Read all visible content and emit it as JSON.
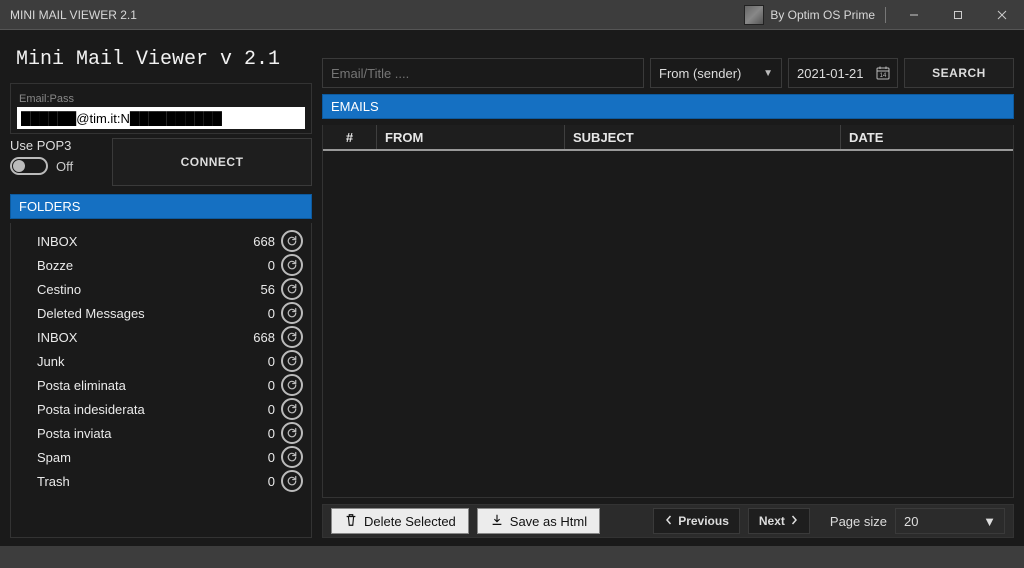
{
  "window": {
    "title": "MINI MAIL VIEWER 2.1",
    "author": "By Optim OS Prime"
  },
  "app": {
    "heading": "Mini Mail Viewer v 2.1"
  },
  "login": {
    "legend": "Email:Pass",
    "credential_value": "██████@tim.it:N██████████"
  },
  "pop3": {
    "label": "Use POP3",
    "state": "Off"
  },
  "connect": {
    "label": "CONNECT"
  },
  "folders_header": "FOLDERS",
  "folders": [
    {
      "name": "INBOX",
      "count": 668
    },
    {
      "name": "Bozze",
      "count": 0
    },
    {
      "name": "Cestino",
      "count": 56
    },
    {
      "name": "Deleted Messages",
      "count": 0
    },
    {
      "name": "INBOX",
      "count": 668
    },
    {
      "name": "Junk",
      "count": 0
    },
    {
      "name": "Posta eliminata",
      "count": 0
    },
    {
      "name": "Posta indesiderata",
      "count": 0
    },
    {
      "name": "Posta inviata",
      "count": 0
    },
    {
      "name": "Spam",
      "count": 0
    },
    {
      "name": "Trash",
      "count": 0
    }
  ],
  "search": {
    "placeholder": "Email/Title ....",
    "mode": "From (sender)",
    "date": "2021-01-21",
    "button": "SEARCH"
  },
  "emails_header": "EMAILS",
  "columns": {
    "num": "#",
    "from": "FROM",
    "subject": "SUBJECT",
    "date": "DATE"
  },
  "footer": {
    "delete": "Delete Selected",
    "save": "Save as Html",
    "prev": "Previous",
    "next": "Next",
    "page_size_label": "Page size",
    "page_size_value": "20"
  }
}
